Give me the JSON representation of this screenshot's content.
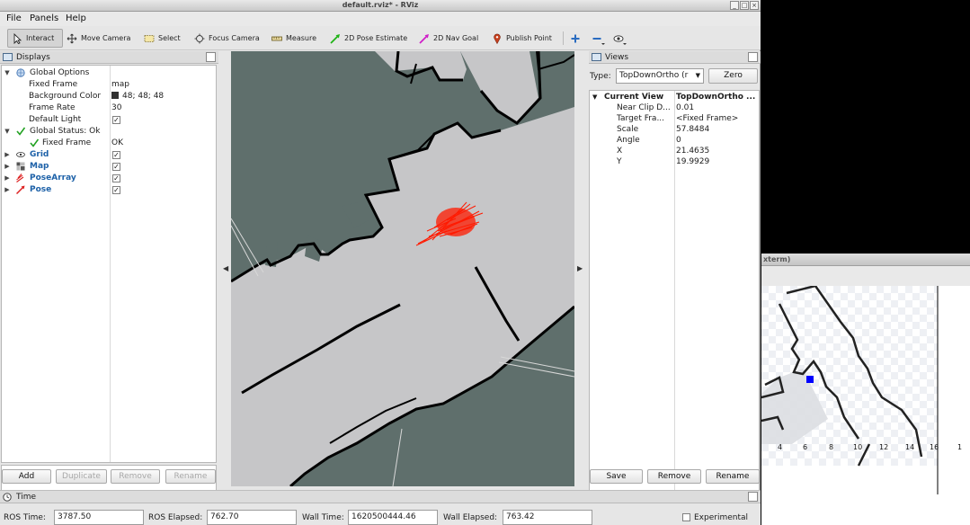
{
  "window": {
    "title": "default.rviz* - RViz",
    "controls": [
      "_",
      "□",
      "×"
    ]
  },
  "menu": [
    "File",
    "Panels",
    "Help"
  ],
  "toolbar": {
    "interact": "Interact",
    "move_camera": "Move Camera",
    "select": "Select",
    "focus_camera": "Focus Camera",
    "measure": "Measure",
    "pose_estimate": "2D Pose Estimate",
    "nav_goal": "2D Nav Goal",
    "publish_point": "Publish Point"
  },
  "displays": {
    "title": "Displays",
    "rows": [
      {
        "label": "Global Options",
        "value": ""
      },
      {
        "label": "Fixed Frame",
        "value": "map"
      },
      {
        "label": "Background Color",
        "value": "48; 48; 48"
      },
      {
        "label": "Frame Rate",
        "value": "30"
      },
      {
        "label": "Default Light",
        "value": "✓"
      },
      {
        "label": "Global Status: Ok",
        "value": ""
      },
      {
        "label": "Fixed Frame",
        "value": "OK"
      },
      {
        "label": "Grid",
        "value": "✓"
      },
      {
        "label": "Map",
        "value": "✓"
      },
      {
        "label": "PoseArray",
        "value": "✓"
      },
      {
        "label": "Pose",
        "value": "✓"
      }
    ],
    "buttons": {
      "add": "Add",
      "duplicate": "Duplicate",
      "remove": "Remove",
      "rename": "Rename"
    }
  },
  "views": {
    "title": "Views",
    "type_label": "Type:",
    "type_value": "TopDownOrtho (r",
    "zero": "Zero",
    "rows": [
      {
        "label": "Current View",
        "value": "TopDownOrtho ..."
      },
      {
        "label": "Near Clip D...",
        "value": "0.01"
      },
      {
        "label": "Target Fra...",
        "value": "<Fixed Frame>"
      },
      {
        "label": "Scale",
        "value": "57.8484"
      },
      {
        "label": "Angle",
        "value": "0"
      },
      {
        "label": "X",
        "value": "21.4635"
      },
      {
        "label": "Y",
        "value": "19.9929"
      }
    ],
    "buttons": {
      "save": "Save",
      "remove": "Remove",
      "rename": "Rename"
    }
  },
  "time": {
    "title": "Time",
    "ros_time_label": "ROS Time:",
    "ros_time": "3787.50",
    "ros_elapsed_label": "ROS Elapsed:",
    "ros_elapsed": "762.70",
    "wall_time_label": "Wall Time:",
    "wall_time": "1620500444.46",
    "wall_elapsed_label": "Wall Elapsed:",
    "wall_elapsed": "763.42",
    "experimental": "Experimental"
  },
  "xterm": {
    "title": "xterm)",
    "axis_ticks": [
      "4",
      "6",
      "8",
      "10",
      "12",
      "14",
      "16"
    ],
    "overflow_tick": "1"
  },
  "colors": {
    "map_unknown": "#5f6f6c",
    "map_free": "#c6c6c8",
    "map_wall": "#000000",
    "particles": "#ff1a00",
    "robot": "#0000ff",
    "accent_blue": "#1d61a8"
  }
}
